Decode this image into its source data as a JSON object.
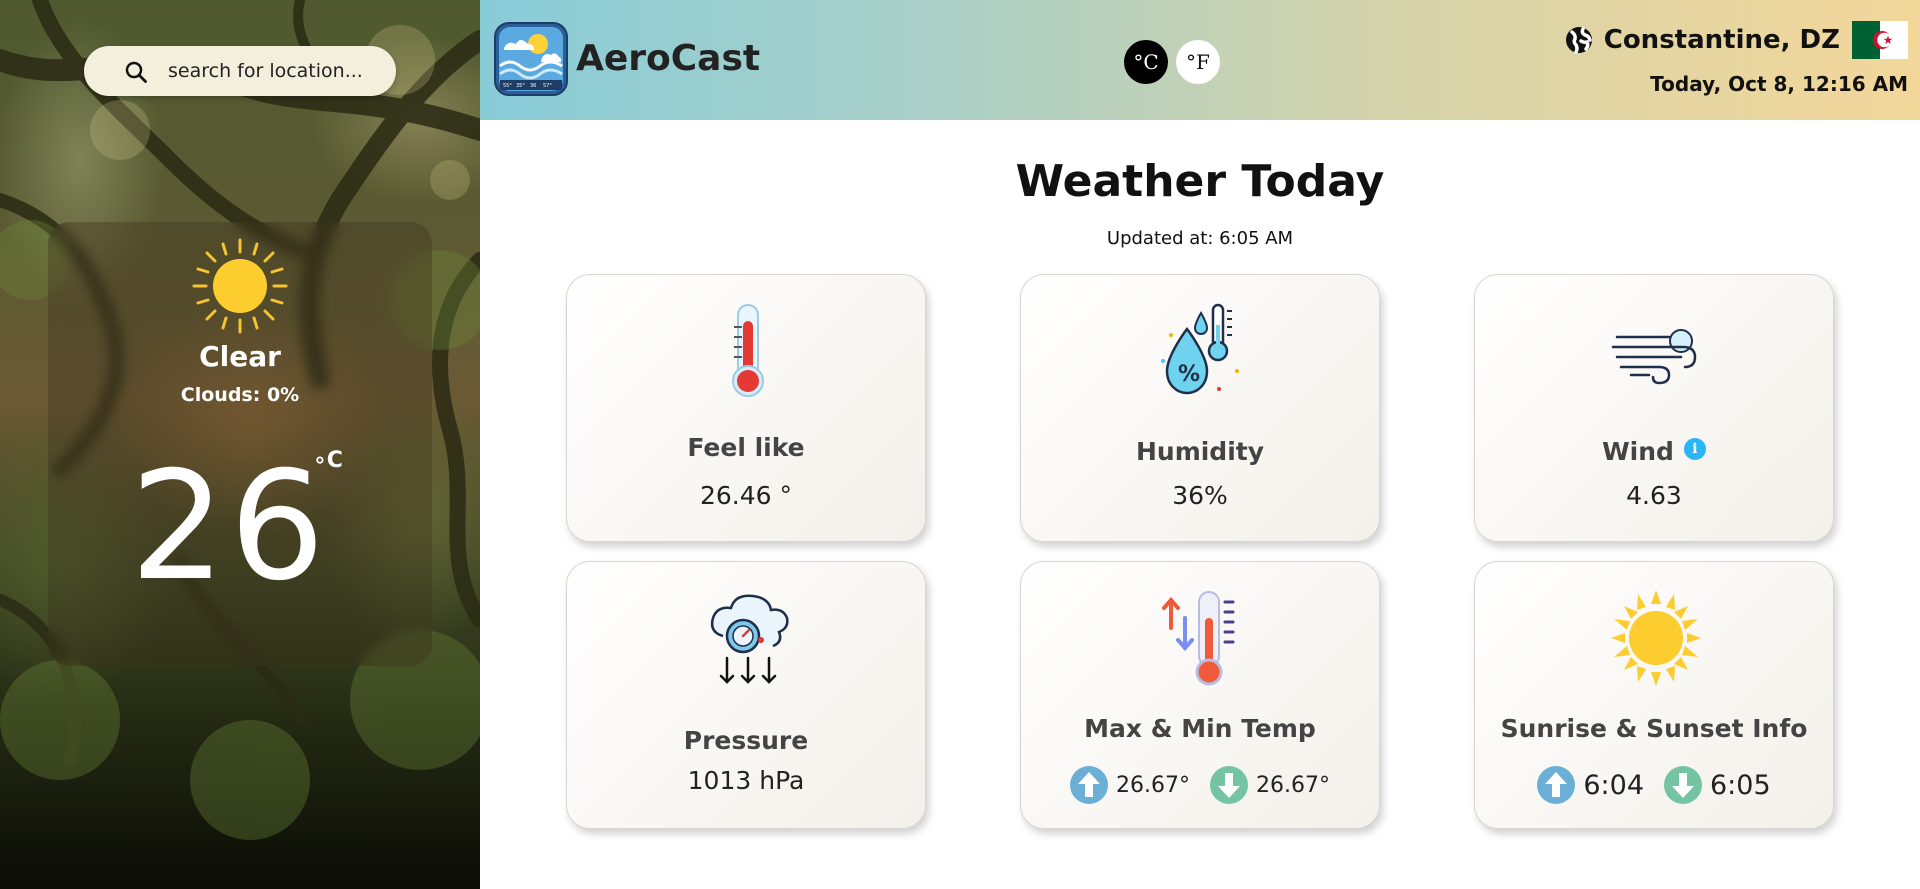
{
  "sidebar": {
    "search": {
      "placeholder": "search for location..."
    },
    "current": {
      "condition": "Clear",
      "clouds": "Clouds: 0%",
      "temperature": "26",
      "unit": "∘C",
      "icon": "sun-icon"
    }
  },
  "header": {
    "brand": "AeroCast",
    "units": {
      "celsius": "°C",
      "fahrenheit": "°F",
      "selected": "celsius"
    },
    "location": "Constantine, DZ",
    "date": "Today, Oct 8, 12:16 AM",
    "flag_colors": {
      "green": "#006233",
      "white": "#ffffff",
      "red": "#d21034"
    }
  },
  "main": {
    "title": "Weather Today",
    "updated": "Updated at: 6:05 AM",
    "cards": {
      "feel_like": {
        "title": "Feel like",
        "value": "26.46 °",
        "icon": "thermometer-icon"
      },
      "humidity": {
        "title": "Humidity",
        "value": "36%",
        "icon": "humidity-icon"
      },
      "wind": {
        "title": "Wind",
        "value": "4.63",
        "icon": "wind-icon",
        "info": "i"
      },
      "pressure": {
        "title": "Pressure",
        "value": "1013 hPa",
        "icon": "pressure-icon"
      },
      "max_min": {
        "title": "Max & Min Temp",
        "max": "26.67°",
        "min": "26.67°",
        "icon": "temp-range-icon"
      },
      "sun": {
        "title": "Sunrise & Sunset Info",
        "sunrise": "6:04",
        "sunset": "6:05",
        "icon": "sun-icon"
      }
    }
  },
  "colors": {
    "header_gradient_start": "#88ccd8",
    "header_gradient_end": "#f3d79a",
    "arrow_up": "#6baed6",
    "arrow_down": "#74c4a4",
    "info": "#29b6f6"
  }
}
